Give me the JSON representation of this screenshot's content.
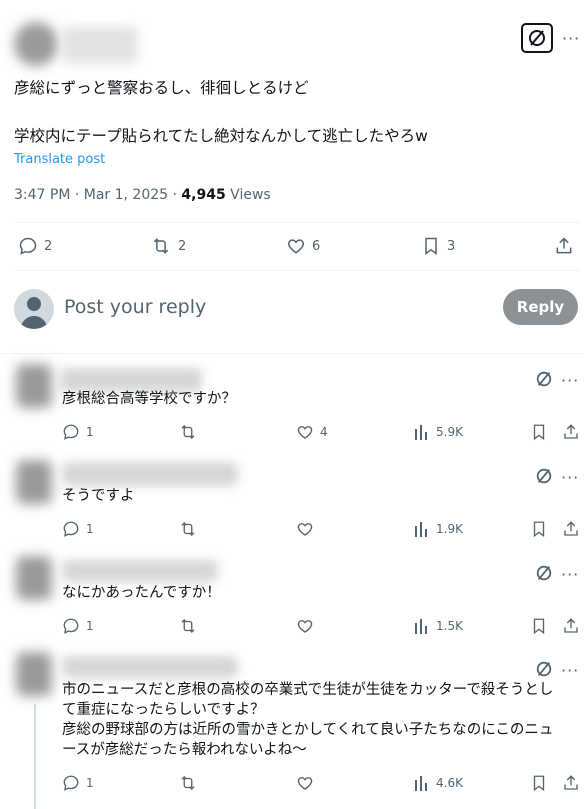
{
  "post": {
    "text_line1": "彦総にずっと警察おるし、徘徊しとるけど",
    "text_line2": "学校内にテープ貼られてたし絶対なんかして逃亡したやろw",
    "translate": "Translate post",
    "time": "3:47 PM · Mar 1, 2025 · ",
    "views_count": "4,945",
    "views_label": " Views",
    "actions": {
      "replies": "2",
      "reposts": "2",
      "likes": "6",
      "bookmarks": "3"
    },
    "more": "···"
  },
  "reply_bar": {
    "placeholder": "Post your reply",
    "button": "Reply"
  },
  "replies": [
    {
      "text": "彦根総合高等学校ですか？",
      "replies": "1",
      "reposts": "",
      "likes": "4",
      "views": "5.9K"
    },
    {
      "text": "そうですよ",
      "replies": "1",
      "reposts": "",
      "likes": "",
      "views": "1.9K"
    },
    {
      "text": "なにかあったんですか！",
      "replies": "1",
      "reposts": "",
      "likes": "",
      "views": "1.5K"
    },
    {
      "text_lines": [
        "市のニュースだと彦根の高校の卒業式で生徒が生徒をカッターで殺そうとし",
        "て重症になったらしいですよ？",
        "彦総の野球部の方は近所の雪かきとかしてくれて良い子たちなのにこのニュ",
        "ースが彦総だったら報われないよね〜"
      ],
      "replies": "1",
      "reposts": "",
      "likes": "",
      "views": "4.6K"
    }
  ],
  "colors": {
    "link": "#1d9bf0",
    "muted": "#536471",
    "text": "#0f1419",
    "button": "#8b9195"
  }
}
